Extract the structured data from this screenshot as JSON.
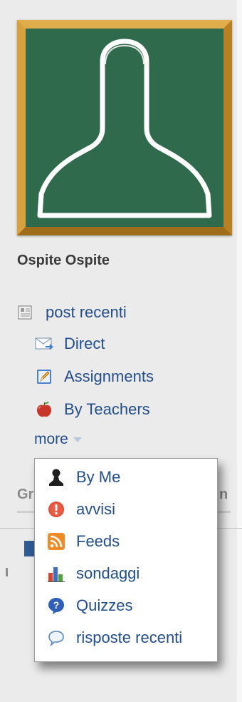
{
  "user": {
    "name": "Ospite Ospite"
  },
  "nav": {
    "items": [
      {
        "label": "post recenti",
        "icon": "newspaper-icon"
      },
      {
        "label": "Direct",
        "icon": "envelope-icon"
      },
      {
        "label": "Assignments",
        "icon": "pencil-icon"
      },
      {
        "label": "By Teachers",
        "icon": "apple-icon"
      }
    ],
    "more_label": "more"
  },
  "groups": {
    "heading_visible": "Gr",
    "right_visible": "n"
  },
  "dropdown": {
    "items": [
      {
        "label": "By Me",
        "icon": "person-icon"
      },
      {
        "label": "avvisi",
        "icon": "alert-icon"
      },
      {
        "label": "Feeds",
        "icon": "rss-icon"
      },
      {
        "label": "sondaggi",
        "icon": "poll-icon"
      },
      {
        "label": "Quizzes",
        "icon": "quiz-icon"
      },
      {
        "label": "risposte recenti",
        "icon": "speech-bubble-icon"
      }
    ]
  },
  "colors": {
    "link": "#234e8c",
    "chalkboard": "#2f6a4c",
    "frame": "#d29b3b",
    "background": "#ebebeb"
  }
}
